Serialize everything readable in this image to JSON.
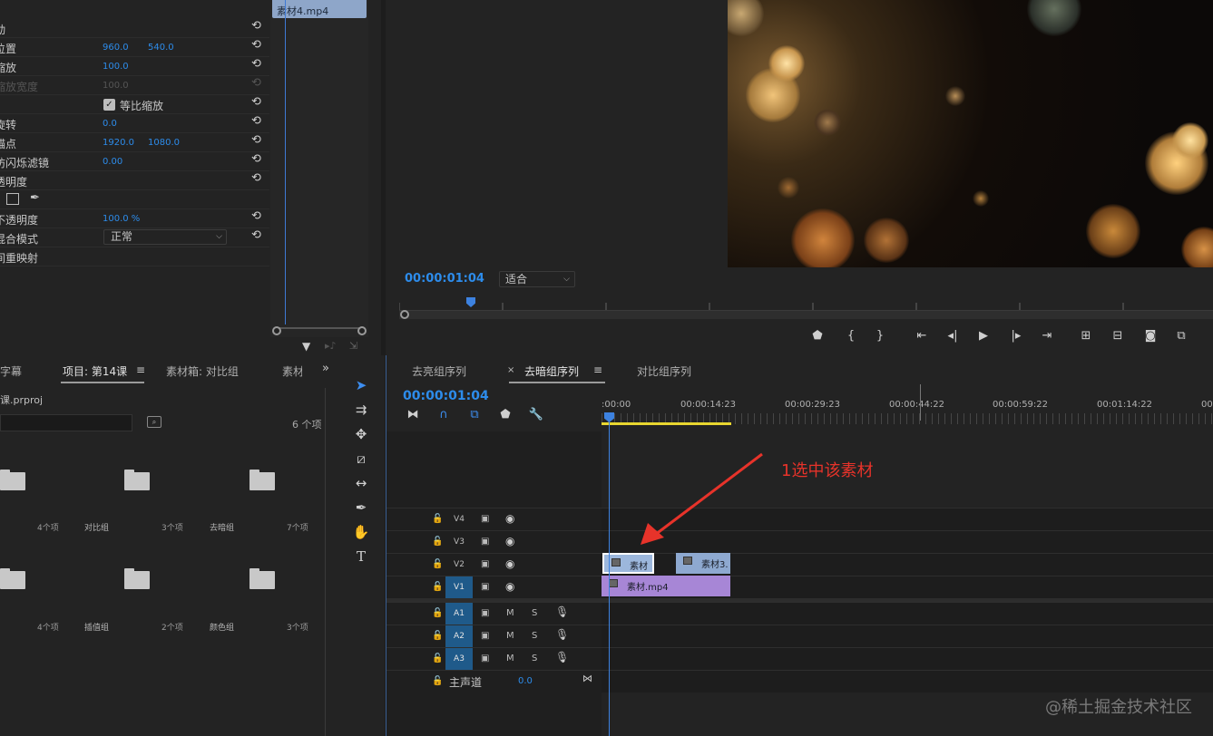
{
  "effect_controls": {
    "clip_tab": "素材4.mp4",
    "rows": [
      {
        "label": "动",
        "v1": "",
        "v2": ""
      },
      {
        "label": "位置",
        "v1": "960.0",
        "v2": "540.0"
      },
      {
        "label": "缩放",
        "v1": "100.0",
        "v2": ""
      },
      {
        "label": "缩放宽度",
        "v1": "100.0",
        "v2": ""
      },
      {
        "label": "",
        "v1": "",
        "v2": ""
      },
      {
        "label": "旋转",
        "v1": "0.0",
        "v2": ""
      },
      {
        "label": "锚点",
        "v1": "1920.0",
        "v2": "1080.0"
      },
      {
        "label": "防闪烁滤镜",
        "v1": "0.00",
        "v2": ""
      },
      {
        "label": "透明度",
        "v1": "",
        "v2": ""
      },
      {
        "label": "",
        "v1": "",
        "v2": ""
      },
      {
        "label": "不透明度",
        "v1": "100.0 %",
        "v2": ""
      },
      {
        "label": "混合模式",
        "v1": "",
        "v2": ""
      },
      {
        "label": "间重映射",
        "v1": "",
        "v2": ""
      }
    ],
    "uniform_scale_label": "等比缩放",
    "blend_mode_value": "正常"
  },
  "program_monitor": {
    "timecode": "00:00:01:04",
    "fit_label": "适合"
  },
  "project_panel": {
    "tabs": [
      "字幕",
      "项目: 第14课",
      "素材箱: 对比组",
      "素材"
    ],
    "file_name": "课.prproj",
    "item_count": "6 个项",
    "items": [
      {
        "count": "4个项",
        "name": "对比组"
      },
      {
        "count": "3个项",
        "name": "去暗组"
      },
      {
        "count": "7个项",
        "name": ""
      },
      {
        "count": "4个项",
        "name": "插值组"
      },
      {
        "count": "2个项",
        "name": "颜色组"
      },
      {
        "count": "3个项",
        "name": ""
      }
    ]
  },
  "timeline": {
    "tabs": [
      "去亮组序列",
      "去暗组序列",
      "对比组序列"
    ],
    "timecode": "00:00:01:04",
    "ruler_labels": [
      ":00:00",
      "00:00:14:23",
      "00:00:29:23",
      "00:00:44:22",
      "00:00:59:22",
      "00:01:14:22",
      "00"
    ],
    "video_tracks": [
      "V4",
      "V3",
      "V2",
      "V1"
    ],
    "audio_tracks": [
      "A1",
      "A2",
      "A3"
    ],
    "master_label": "主声道",
    "master_value": "0.0",
    "mute_label": "M",
    "solo_label": "S",
    "clips": {
      "v2_a": "素材",
      "v2_b": "素材3.",
      "v1": "素材.mp4"
    },
    "annotation": "1选中该素材"
  },
  "watermark": "@稀土掘金技术社区"
}
